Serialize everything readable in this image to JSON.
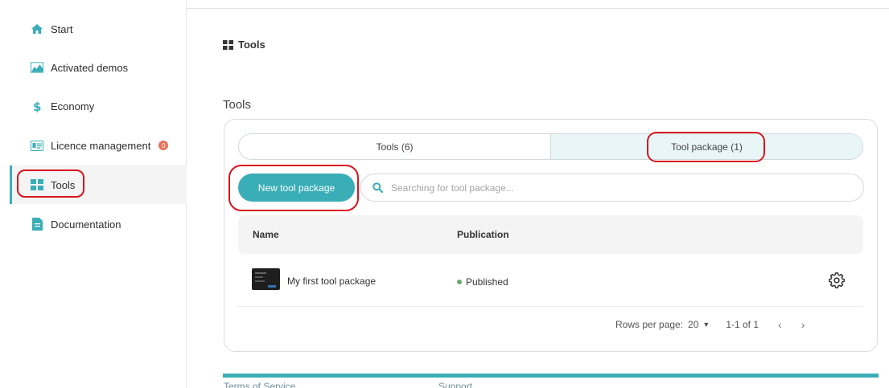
{
  "sidebar": {
    "items": [
      {
        "label": "Start",
        "icon": "home-icon"
      },
      {
        "label": "Activated demos",
        "icon": "area-chart-icon"
      },
      {
        "label": "Economy",
        "icon": "dollar-icon"
      },
      {
        "label": "Licence management",
        "icon": "id-card-icon",
        "badge": "0"
      },
      {
        "label": "Tools",
        "icon": "grid-icon",
        "active": true
      },
      {
        "label": "Documentation",
        "icon": "document-icon"
      }
    ]
  },
  "breadcrumb": {
    "label": "Tools",
    "icon": "grid-icon"
  },
  "main": {
    "section_title": "Tools",
    "tabs": [
      {
        "label": "Tools (6)"
      },
      {
        "label": "Tool package (1)",
        "active": true
      }
    ],
    "new_button_label": "New tool package",
    "search": {
      "placeholder": "Searching for tool package..."
    },
    "table": {
      "columns": [
        "Name",
        "Publication"
      ],
      "rows": [
        {
          "name": "My first tool package",
          "status": "Published"
        }
      ]
    },
    "pagination": {
      "rows_label": "Rows per page:",
      "rows_value": "20",
      "range": "1-1 of 1",
      "prev": "‹",
      "next": "›"
    }
  },
  "footer": {
    "links": [
      "Terms of Service",
      "Support"
    ]
  },
  "colors": {
    "accent": "#3aaeb7",
    "annotation": "#d8141c",
    "published_dot": "#6aa86a",
    "badge": "#e8735a"
  }
}
